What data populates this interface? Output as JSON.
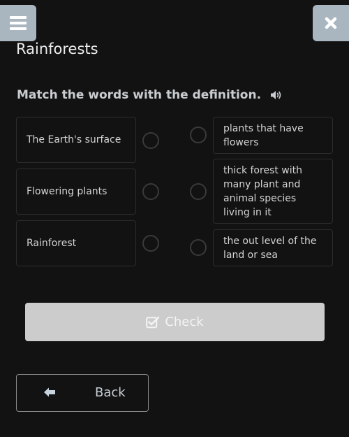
{
  "header": {
    "menu_icon": "hamburger-menu-icon",
    "close_icon": "close-x-icon",
    "title": "Rainforests"
  },
  "question": {
    "instruction": "Match the words with the definition.",
    "audio_icon": "speaker-icon"
  },
  "terms": [
    {
      "label": "The Earth's surface",
      "selected": false
    },
    {
      "label": "Flowering plants",
      "selected": false
    },
    {
      "label": "Rainforest",
      "selected": false
    }
  ],
  "definitions": [
    {
      "label": "plants that have flowers",
      "selected": false
    },
    {
      "label": "thick forest with many plant and animal species living in it",
      "selected": false
    },
    {
      "label": "the out level of the land or sea",
      "selected": false
    }
  ],
  "actions": {
    "check_label": "Check",
    "check_icon": "checkbox-icon",
    "check_enabled": false,
    "back_label": "Back",
    "back_icon": "arrow-left-icon"
  },
  "colors": {
    "background": "#121212",
    "header_button": "#a9b6c0",
    "check_button_disabled": "#cccccc"
  }
}
